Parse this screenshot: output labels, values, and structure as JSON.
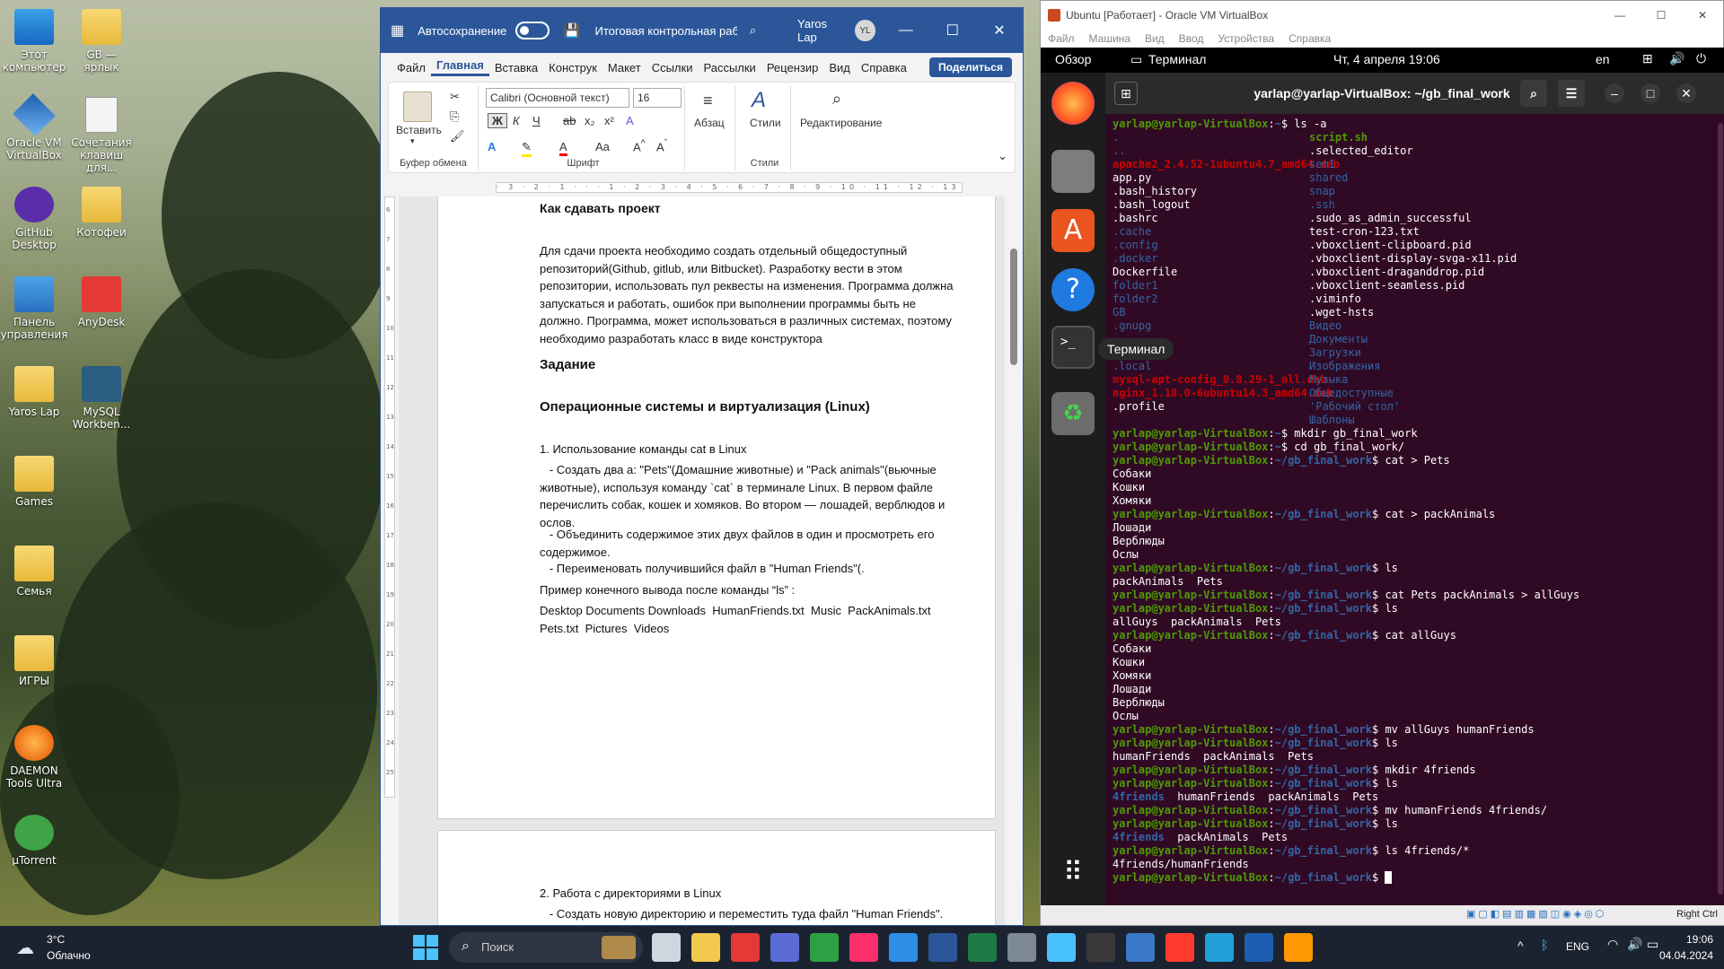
{
  "desktop": {
    "icons": [
      {
        "label": "Этот компьютер",
        "icon": "computer-icon"
      },
      {
        "label": "GB — ярлык",
        "icon": "folder-shortcut-icon"
      },
      {
        "label": "Oracle VM VirtualBox",
        "icon": "virtualbox-icon"
      },
      {
        "label": "Сочетания клавиш для...",
        "icon": "document-icon"
      },
      {
        "label": "GitHub Desktop",
        "icon": "github-icon"
      },
      {
        "label": "Котофеи",
        "icon": "folder-icon"
      },
      {
        "label": "Панель управления",
        "icon": "control-panel-icon"
      },
      {
        "label": "AnyDesk",
        "icon": "anydesk-icon"
      },
      {
        "label": "Yaros Lap",
        "icon": "folder-icon"
      },
      {
        "label": "MySQL Workben...",
        "icon": "mysql-icon"
      },
      {
        "label": "Games",
        "icon": "folder-icon"
      },
      {
        "label": "Семья",
        "icon": "folder-icon"
      },
      {
        "label": "ИГРЫ",
        "icon": "folder-icon"
      },
      {
        "label": "DAEMON Tools Ultra",
        "icon": "daemon-tools-icon"
      },
      {
        "label": "µTorrent",
        "icon": "utorrent-icon"
      }
    ]
  },
  "word": {
    "autosave_label": "Автосохранение",
    "doc_title": "Итоговая контрольная раб...",
    "user_name": "Yaros Lap",
    "user_initials": "YL",
    "tabs": [
      "Файл",
      "Главная",
      "Вставка",
      "Конструк",
      "Макет",
      "Ссылки",
      "Рассылки",
      "Рецензир",
      "Вид",
      "Справка"
    ],
    "share_label": "Поделиться",
    "ribbon": {
      "paste": "Вставить",
      "clipboard": "Буфер обмена",
      "font_name": "Calibri (Основной текст)",
      "font_size": "16",
      "font_group": "Шрифт",
      "paragraph": "Абзац",
      "styles": "Стили",
      "styles_group": "Стили",
      "editing": "Редактирование"
    },
    "ruler_marks": "· 3 · 2 · 1 · · · 1 · 2 · 3 · 4 · 5 · 6 · 7 · 8 · 9 · 10 · 11 · 12 · 13 · 14 · 15 · 16 · 17",
    "vruler_marks": [
      "6",
      "7",
      "8",
      "9",
      "10",
      "11",
      "12",
      "13",
      "14",
      "15",
      "16",
      "17",
      "18",
      "19",
      "20",
      "21",
      "22",
      "23",
      "24",
      "25"
    ],
    "page1": {
      "heading1": "Как сдавать проект",
      "para1": [
        "Для сдачи проекта необходимо создать отдельный общедоступный",
        "репозиторий(Github, gitlub, или Bitbucket). Разработку вести в этом",
        "репозитории, использовать пул реквесты на изменения. Программа должна",
        "запускаться и работать, ошибок при выполнении программы быть не",
        "должно. Программа, может использоваться в различных системах, поэтому",
        "необходимо разработать класс в виде конструктора"
      ],
      "heading2": "Задание",
      "heading3": "Операционные системы и виртуализация (Linux)",
      "item1": "1. Использование команды cat в Linux",
      "item1a": [
        "   - Создать два а: \"Pets\"(Домашние животные) и \"Pack animals\"(вьючные",
        "животные), используя команду `cat` в терминале Linux. В первом файле",
        "перечислить собак, кошек и хомяков. Во втором — лошадей, верблюдов и",
        "ослов."
      ],
      "item1b": [
        "   - Объединить содержимое этих двух файлов в один и просмотреть его",
        "содержимое."
      ],
      "item1c": "   - Переименовать получившийся файл в \"Human Friends\"(.",
      "example": "Пример конечного вывода после команды “ls” :",
      "output": [
        "Desktop Documents Downloads  HumanFriends.txt  Music  PackAnimals.txt",
        "Pets.txt  Pictures  Videos"
      ]
    },
    "page2": {
      "item2": "2. Работа с директориями в Linux",
      "item2a": "   - Создать новую директорию и переместить туда файл \"Human Friends\"."
    }
  },
  "vbox": {
    "title": "Ubuntu [Работает] - Oracle VM VirtualBox",
    "menu": [
      "Файл",
      "Машина",
      "Вид",
      "Ввод",
      "Устройства",
      "Справка"
    ],
    "ubuntu_top": {
      "overview": "Обзор",
      "app": "Терминал",
      "clock": "Чт, 4 апреля  19:06",
      "lang": "en"
    },
    "tooltip": "Терминал",
    "term_title": "yarlap@yarlap-VirtualBox: ~/gb_final_work",
    "prompt_user": "yarlap@yarlap-VirtualBox",
    "status_right": "Right Ctrl"
  },
  "terminal": {
    "ls_left": [
      {
        "t": ".",
        "c": "bl"
      },
      {
        "t": "..",
        "c": "bl"
      },
      {
        "t": "apache2_2.4.52-1ubuntu4.7_amd64.deb",
        "c": "rd"
      },
      {
        "t": "app.py",
        "c": ""
      },
      {
        "t": ".bash_history",
        "c": ""
      },
      {
        "t": ".bash_logout",
        "c": ""
      },
      {
        "t": ".bashrc",
        "c": ""
      },
      {
        "t": ".cache",
        "c": "bl"
      },
      {
        "t": ".config",
        "c": "bl"
      },
      {
        "t": ".docker",
        "c": "bl"
      },
      {
        "t": "Dockerfile",
        "c": ""
      },
      {
        "t": "folder1",
        "c": "bl"
      },
      {
        "t": "folder2",
        "c": "bl"
      },
      {
        "t": "GB",
        "c": "bl"
      },
      {
        "t": ".gnupg",
        "c": "bl"
      },
      {
        "t": "",
        "c": ""
      },
      {
        "t": ".lesshst",
        "c": ""
      },
      {
        "t": ".local",
        "c": "bl"
      },
      {
        "t": "mysql-apt-config_0.8.29-1_all.deb",
        "c": "rd"
      },
      {
        "t": "nginx_1.18.0-6ubuntu14.3_amd64.deb",
        "c": "rd"
      },
      {
        "t": ".profile",
        "c": ""
      }
    ],
    "ls_right": [
      {
        "t": "script.sh",
        "c": "gr"
      },
      {
        "t": ".selected_editor",
        "c": ""
      },
      {
        "t": "sem1",
        "c": "bl"
      },
      {
        "t": "shared",
        "c": "bl"
      },
      {
        "t": "snap",
        "c": "bl"
      },
      {
        "t": ".ssh",
        "c": "bl"
      },
      {
        "t": ".sudo_as_admin_successful",
        "c": ""
      },
      {
        "t": "test-cron-123.txt",
        "c": ""
      },
      {
        "t": ".vboxclient-clipboard.pid",
        "c": ""
      },
      {
        "t": ".vboxclient-display-svga-x11.pid",
        "c": ""
      },
      {
        "t": ".vboxclient-draganddrop.pid",
        "c": ""
      },
      {
        "t": ".vboxclient-seamless.pid",
        "c": ""
      },
      {
        "t": ".viminfo",
        "c": ""
      },
      {
        "t": ".wget-hsts",
        "c": ""
      },
      {
        "t": "Видео",
        "c": "bl"
      },
      {
        "t": "Документы",
        "c": "bl"
      },
      {
        "t": "Загрузки",
        "c": "bl"
      },
      {
        "t": "Изображения",
        "c": "bl"
      },
      {
        "t": "Музыка",
        "c": "bl"
      },
      {
        "t": "Общедоступные",
        "c": "bl"
      },
      {
        "t": "'Рабочий стол'",
        "c": "bl"
      },
      {
        "t": "Шаблоны",
        "c": "bl"
      }
    ],
    "lines": [
      {
        "p": "~",
        "cmd": "ls -a"
      },
      {
        "p": "~",
        "cmd": "mkdir gb_final_work"
      },
      {
        "p": "~",
        "cmd": "cd gb_final_work/"
      },
      {
        "p": "~/gb_final_work",
        "cmd": "cat > Pets"
      },
      {
        "out": "Собаки"
      },
      {
        "out": "Кошки"
      },
      {
        "out": "Хомяки"
      },
      {
        "p": "~/gb_final_work",
        "cmd": "cat > packAnimals"
      },
      {
        "out": "Лошади"
      },
      {
        "out": "Верблюды"
      },
      {
        "out": "Ослы"
      },
      {
        "p": "~/gb_final_work",
        "cmd": "ls"
      },
      {
        "out": "packAnimals  Pets"
      },
      {
        "p": "~/gb_final_work",
        "cmd": "cat Pets packAnimals > allGuys"
      },
      {
        "p": "~/gb_final_work",
        "cmd": "ls"
      },
      {
        "out": "allGuys  packAnimals  Pets"
      },
      {
        "p": "~/gb_final_work",
        "cmd": "cat allGuys"
      },
      {
        "out": "Собаки"
      },
      {
        "out": "Кошки"
      },
      {
        "out": "Хомяки"
      },
      {
        "out": "Лошади"
      },
      {
        "out": "Верблюды"
      },
      {
        "out": "Ослы"
      },
      {
        "p": "~/gb_final_work",
        "cmd": "mv allGuys humanFriends"
      },
      {
        "p": "~/gb_final_work",
        "cmd": "ls"
      },
      {
        "out": "humanFriends  packAnimals  Pets"
      },
      {
        "p": "~/gb_final_work",
        "cmd": "mkdir 4friends"
      },
      {
        "p": "~/gb_final_work",
        "cmd": "ls"
      },
      {
        "out": "4friends  humanFriends  packAnimals  Pets",
        "first_blue": "4friends"
      },
      {
        "p": "~/gb_final_work",
        "cmd": "mv humanFriends 4friends/"
      },
      {
        "p": "~/gb_final_work",
        "cmd": "ls"
      },
      {
        "out": "4friends  packAnimals  Pets",
        "first_blue": "4friends"
      },
      {
        "p": "~/gb_final_work",
        "cmd": "ls 4friends/*"
      },
      {
        "out": "4friends/humanFriends"
      },
      {
        "p": "~/gb_final_work",
        "cmd": "",
        "cursor": true
      }
    ]
  },
  "taskbar": {
    "weather_temp": "3°C",
    "weather_desc": "Облачно",
    "search_placeholder": "Поиск",
    "lang": "ENG",
    "time": "19:06",
    "date": "04.04.2024"
  }
}
